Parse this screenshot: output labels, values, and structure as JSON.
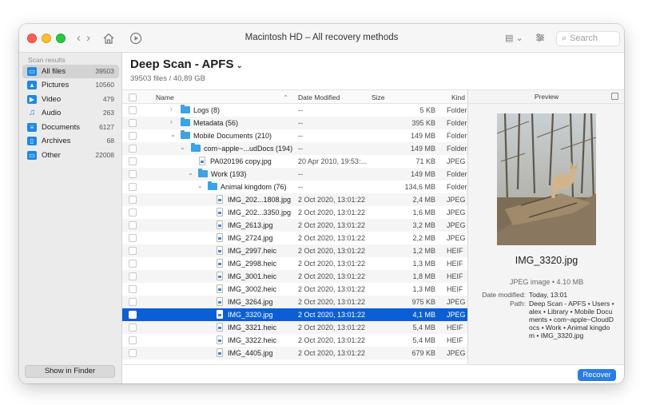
{
  "window": {
    "title": "Macintosh HD – All recovery methods"
  },
  "toolbar": {
    "back": "‹",
    "forward": "›",
    "search_placeholder": "Search"
  },
  "sidebar": {
    "title": "Scan results",
    "items": [
      {
        "label": "All files",
        "count": "39503",
        "icon": "all-files-icon",
        "color": "#1e88e5"
      },
      {
        "label": "Pictures",
        "count": "10560",
        "icon": "pictures-icon",
        "color": "#1e88e5"
      },
      {
        "label": "Video",
        "count": "479",
        "icon": "video-icon",
        "color": "#1e88e5"
      },
      {
        "label": "Audio",
        "count": "263",
        "icon": "audio-icon",
        "color": "#1e88e5"
      },
      {
        "label": "Documents",
        "count": "6127",
        "icon": "documents-icon",
        "color": "#1e88e5"
      },
      {
        "label": "Archives",
        "count": "68",
        "icon": "archives-icon",
        "color": "#1e88e5"
      },
      {
        "label": "Other",
        "count": "22008",
        "icon": "other-icon",
        "color": "#1e88e5"
      }
    ],
    "show_in_finder": "Show in Finder"
  },
  "header": {
    "title": "Deep Scan - APFS",
    "subtitle": "39503 files / 40,89 GB"
  },
  "table": {
    "columns": {
      "name": "Name",
      "date": "Date Modified",
      "size": "Size",
      "kind": "Kind"
    },
    "rows": [
      {
        "name": "Logs (8)",
        "date": "--",
        "size": "5 KB",
        "kind": "Folder"
      },
      {
        "name": "Metadata (56)",
        "date": "--",
        "size": "395 KB",
        "kind": "Folder"
      },
      {
        "name": "Mobile Documents (210)",
        "date": "--",
        "size": "149 MB",
        "kind": "Folder"
      },
      {
        "name": "com~apple~...udDocs (194)",
        "date": "--",
        "size": "149 MB",
        "kind": "Folder"
      },
      {
        "name": "PA020196 copy.jpg",
        "date": "20 Apr 2010, 19:53:...",
        "size": "71 KB",
        "kind": "JPEG"
      },
      {
        "name": "Work (193)",
        "date": "--",
        "size": "149 MB",
        "kind": "Folder"
      },
      {
        "name": "Animal kingdom (76)",
        "date": "--",
        "size": "134,6 MB",
        "kind": "Folder"
      },
      {
        "name": "IMG_202...1808.jpg",
        "date": "2 Oct 2020, 13:01:22",
        "size": "2,4 MB",
        "kind": "JPEG"
      },
      {
        "name": "IMG_202...3350.jpg",
        "date": "2 Oct 2020, 13:01:22",
        "size": "1,6 MB",
        "kind": "JPEG"
      },
      {
        "name": "IMG_2613.jpg",
        "date": "2 Oct 2020, 13:01:22",
        "size": "3,2 MB",
        "kind": "JPEG"
      },
      {
        "name": "IMG_2724.jpg",
        "date": "2 Oct 2020, 13:01:22",
        "size": "2,2 MB",
        "kind": "JPEG"
      },
      {
        "name": "IMG_2997.heic",
        "date": "2 Oct 2020, 13:01:22",
        "size": "1,2 MB",
        "kind": "HEIF"
      },
      {
        "name": "IMG_2998.heic",
        "date": "2 Oct 2020, 13:01:22",
        "size": "1,3 MB",
        "kind": "HEIF"
      },
      {
        "name": "IMG_3001.heic",
        "date": "2 Oct 2020, 13:01:22",
        "size": "1,8 MB",
        "kind": "HEIF"
      },
      {
        "name": "IMG_3002.heic",
        "date": "2 Oct 2020, 13:01:22",
        "size": "1,3 MB",
        "kind": "HEIF"
      },
      {
        "name": "IMG_3264.jpg",
        "date": "2 Oct 2020, 13:01:22",
        "size": "975 KB",
        "kind": "JPEG"
      },
      {
        "name": "IMG_3320.jpg",
        "date": "2 Oct 2020, 13:01:22",
        "size": "4,1 MB",
        "kind": "JPEG"
      },
      {
        "name": "IMG_3321.heic",
        "date": "2 Oct 2020, 13:01:22",
        "size": "5,4 MB",
        "kind": "HEIF"
      },
      {
        "name": "IMG_3322.heic",
        "date": "2 Oct 2020, 13:01:22",
        "size": "5,4 MB",
        "kind": "HEIF"
      },
      {
        "name": "IMG_4405.jpg",
        "date": "2 Oct 2020, 13:01:22",
        "size": "679 KB",
        "kind": "JPEG"
      }
    ]
  },
  "preview": {
    "header": "Preview",
    "filename": "IMG_3320.jpg",
    "meta": "JPEG image • 4.10 MB",
    "date_label": "Date modified:",
    "date_value": "Today, 13:01",
    "path_label": "Path:",
    "path_lines": [
      "Deep Scan - APFS • Users •",
      "alex • Library • Mobile Docu",
      "ments • com~apple~CloudD",
      "ocs • Work • Animal kingdo",
      "m • IMG_3320.jpg"
    ]
  },
  "footer": {
    "recover": "Recover"
  },
  "colors": {
    "accent": "#0a5fd6",
    "folder": "#3ba3e6",
    "recover": "#2a7de8"
  }
}
